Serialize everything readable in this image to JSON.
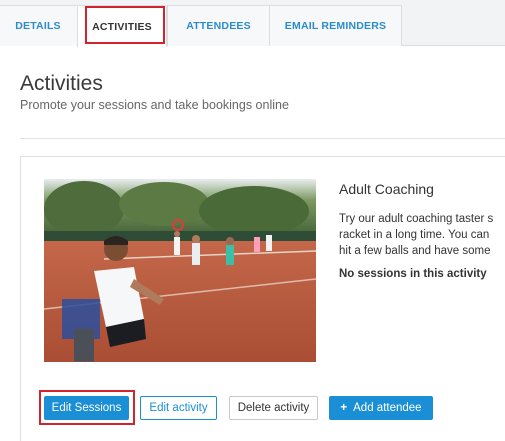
{
  "tabs": [
    {
      "label": "DETAILS"
    },
    {
      "label": "ACTIVITIES"
    },
    {
      "label": "ATTENDEES"
    },
    {
      "label": "EMAIL REMINDERS"
    }
  ],
  "header": {
    "title": "Activities",
    "subtitle": "Promote your sessions and take bookings online"
  },
  "activity": {
    "title": "Adult Coaching",
    "description_lines": [
      "Try our adult coaching taster s",
      "racket in a long time. You can",
      "hit a few balls and have some"
    ],
    "status": "No sessions in this activity",
    "image_alt": "tennis coaching photo"
  },
  "actions": {
    "edit_sessions": "Edit Sessions",
    "edit_activity": "Edit activity",
    "delete_activity": "Delete activity",
    "add_attendee": "Add attendee",
    "add_icon": "plus-icon"
  },
  "colors": {
    "accent": "#1a8fd5",
    "highlight": "#d1242f"
  }
}
